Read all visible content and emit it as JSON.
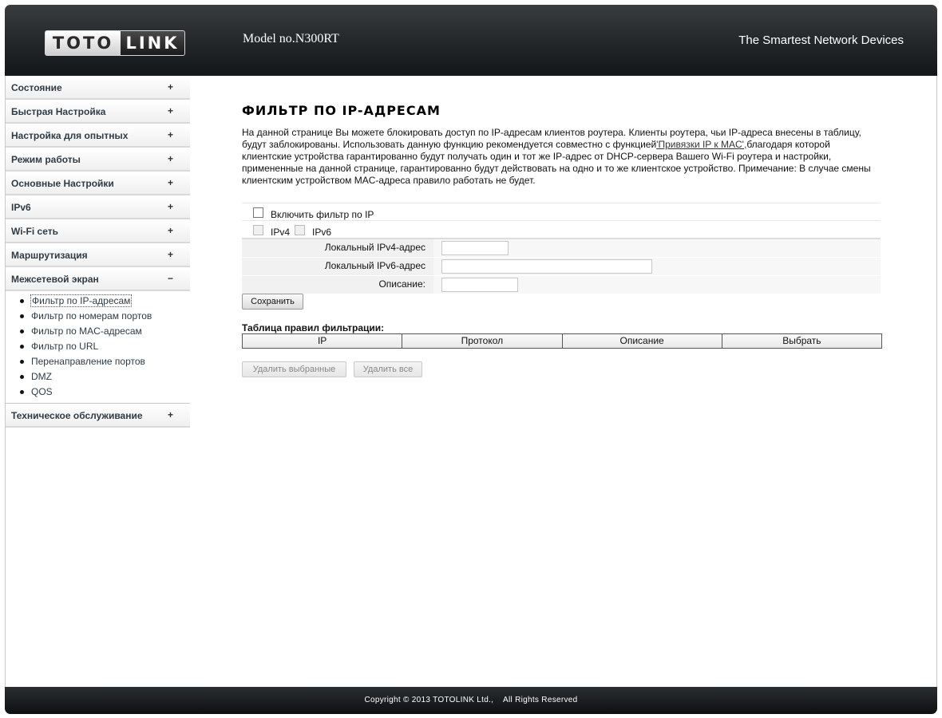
{
  "header": {
    "logo_left": "TOTO",
    "logo_right": "LINK",
    "model": "Model no.N300RT",
    "slogan": "The Smartest Network Devices"
  },
  "sidebar": {
    "items_before": [
      {
        "label": "Состояние",
        "sign": "+"
      },
      {
        "label": "Быстрая Настройка",
        "sign": "+"
      },
      {
        "label": "Настройка для опытных",
        "sign": "+"
      },
      {
        "label": "Режим работы",
        "sign": "+"
      },
      {
        "label": "Основные Настройки",
        "sign": "+"
      },
      {
        "label": "IPv6",
        "sign": "+"
      },
      {
        "label": "Wi-Fi сеть",
        "sign": "+"
      },
      {
        "label": "Маршрутизация",
        "sign": "+"
      }
    ],
    "firewall": {
      "label": "Межсетевой экран",
      "sign": "−"
    },
    "submenu": [
      {
        "label": "Фильтр по IP-адресам"
      },
      {
        "label": "Фильтр по номерам портов"
      },
      {
        "label": "Фильтр по MAC-адресам"
      },
      {
        "label": "Фильтр по URL"
      },
      {
        "label": "Перенаправление портов"
      },
      {
        "label": "DMZ"
      },
      {
        "label": "QOS"
      }
    ],
    "maintenance": {
      "label": "Техническое обслуживание",
      "sign": "+"
    }
  },
  "main": {
    "title": "ФИЛЬТР ПО IP-АДРЕСАМ",
    "desc_part1": "На данной странице Вы можете блокировать доступ по IP-адресам клиентов роутера. Клиенты роутера, чьи IP-адреса внесены в таблицу, будут заблокированы. Использовать данную функцию рекомендуется совместно с функцией",
    "desc_link": "'Привязки IP к MAC',",
    "desc_part2": "благодаря которой клиентские устройства гарантированно будут получать один и тот же IP-адрес от DHCP-сервера Вашего Wi-Fi роутера и настройки, примененные на данной странице, гарантированно будут действовать на одно и то же клиентское устройство. Примечание: В случае смены клиентским устройством MAC-адреса правило работать не будет.",
    "enable_label": "Включить фильтр по IP",
    "ipv4_label": "IPv4",
    "ipv6_label": "IPv6",
    "fields": {
      "ipv4_label": "Локальный IPv4-адрес",
      "ipv4_value": "",
      "ipv6_label": "Локальный IPv6-адрес",
      "ipv6_value": "",
      "desc_label": "Описание:",
      "desc_value": ""
    },
    "save_button": "Сохранить",
    "rules_title": "Таблица правил фильтрации:",
    "rules_columns": [
      "IP",
      "Протокол",
      "Описание",
      "Выбрать"
    ],
    "delete_selected_button": "Удалить выбранные",
    "delete_all_button": "Удалить все"
  },
  "footer": {
    "copyright": "Copyright © 2013 TOTOLINK Ltd.,    All Rights Reserved"
  }
}
